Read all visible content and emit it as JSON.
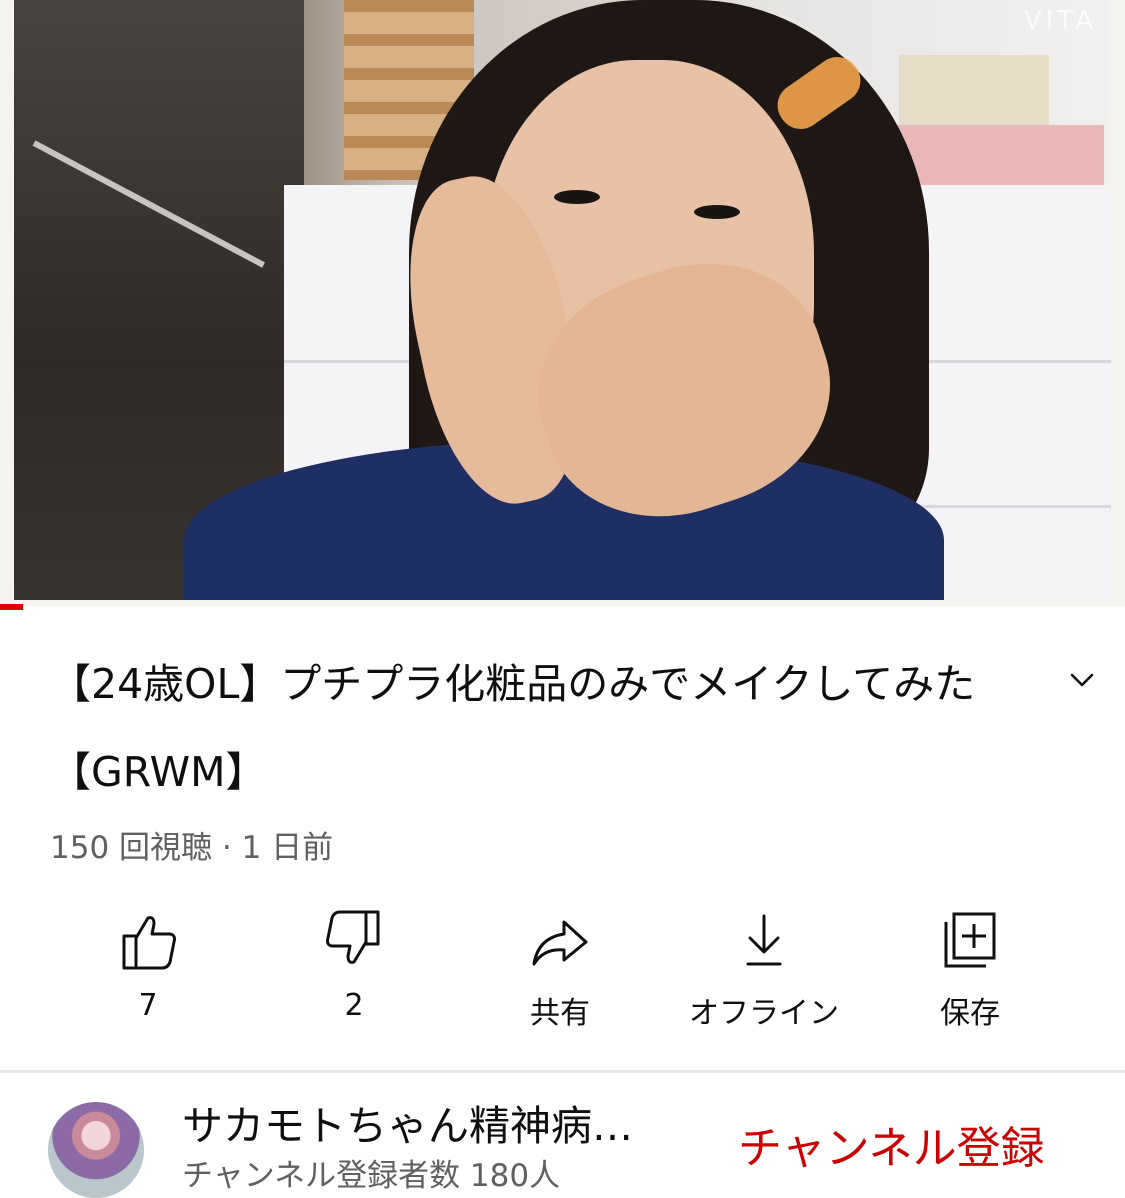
{
  "player": {
    "watermark": "VITA",
    "progress_fraction": 0.02,
    "progress_color": "#e10000"
  },
  "video": {
    "title": "【24歳OL】プチプラ化粧品のみでメイクしてみた【GRWM】",
    "meta": "150 回視聴 · 1 日前",
    "expand_icon": "chevron-down-icon"
  },
  "actions": [
    {
      "icon": "thumbs-up-icon",
      "label": "7"
    },
    {
      "icon": "thumbs-down-icon",
      "label": "2"
    },
    {
      "icon": "share-icon",
      "label": "共有"
    },
    {
      "icon": "download-icon",
      "label": "オフライン"
    },
    {
      "icon": "save-to-playlist-icon",
      "label": "保存"
    }
  ],
  "channel": {
    "name": "サカモトちゃん精神病…",
    "subscribers": "チャンネル登録者数 180人",
    "subscribe_label": "チャンネル登録",
    "subscribe_color": "#cc0000"
  }
}
